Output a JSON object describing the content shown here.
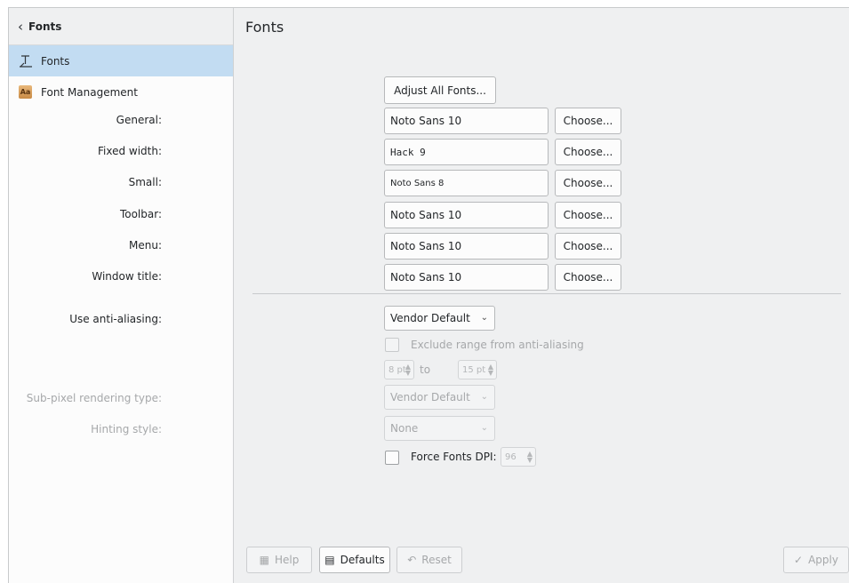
{
  "sidebar": {
    "back_label": "Fonts",
    "items": [
      {
        "label": "Fonts",
        "icon": "fonts-icon"
      },
      {
        "label": "Font Management",
        "icon": "font-management-icon",
        "icon_text": "Aa"
      }
    ]
  },
  "page_title": "Fonts",
  "adjust_all_label": "Adjust All Fonts...",
  "font_rows": [
    {
      "label": "General:",
      "value": "Noto Sans 10",
      "button": "Choose..."
    },
    {
      "label": "Fixed width:",
      "value": "Hack 9",
      "button": "Choose..."
    },
    {
      "label": "Small:",
      "value": "Noto Sans 8",
      "button": "Choose..."
    },
    {
      "label": "Toolbar:",
      "value": "Noto Sans 10",
      "button": "Choose..."
    },
    {
      "label": "Menu:",
      "value": "Noto Sans 10",
      "button": "Choose..."
    },
    {
      "label": "Window title:",
      "value": "Noto Sans 10",
      "button": "Choose..."
    }
  ],
  "anti_aliasing": {
    "label": "Use anti-aliasing:",
    "value": "Vendor Default",
    "exclude_label": "Exclude range from anti-aliasing",
    "range_from": "8 pt",
    "range_to_label": "to",
    "range_to": "15 pt"
  },
  "subpixel": {
    "label": "Sub-pixel rendering type:",
    "value": "Vendor Default"
  },
  "hinting": {
    "label": "Hinting style:",
    "value": "None"
  },
  "force_dpi": {
    "label": "Force Fonts DPI:",
    "value": "96"
  },
  "footer": {
    "help": "Help",
    "defaults": "Defaults",
    "reset": "Reset",
    "apply": "Apply"
  }
}
